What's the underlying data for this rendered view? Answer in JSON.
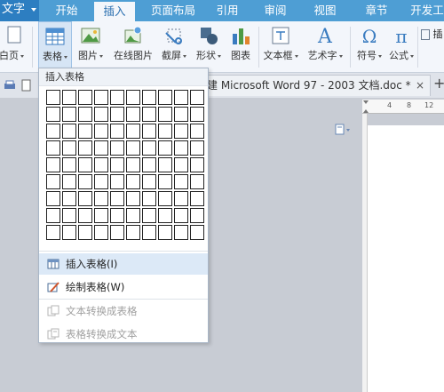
{
  "app_button": {
    "label": "文字"
  },
  "tabs": [
    {
      "label": "开始",
      "active": false
    },
    {
      "label": "插入",
      "active": true
    },
    {
      "label": "页面布局",
      "active": false
    },
    {
      "label": "引用",
      "active": false
    },
    {
      "label": "审阅",
      "active": false
    },
    {
      "label": "视图",
      "active": false
    },
    {
      "label": "章节",
      "active": false
    },
    {
      "label": "开发工",
      "active": false
    }
  ],
  "ribbon": {
    "cover_page": "白页",
    "table": "表格",
    "picture": "图片",
    "online_picture": "在线图片",
    "screenshot": "截屏",
    "shapes": "形状",
    "chart": "图表",
    "textbox": "文本框",
    "wordart": "艺术字",
    "symbol": "符号",
    "formula": "公式",
    "insert_short": "插"
  },
  "document_tab": {
    "title": "建 Microsoft Word 97 - 2003 文档.doc *",
    "close": "×"
  },
  "new_tab": "+",
  "ruler": {
    "ticks": [
      "4",
      "8",
      "12"
    ]
  },
  "table_menu": {
    "header": "插入表格",
    "grid_columns": 10,
    "grid_rows": 9,
    "items": [
      {
        "label": "插入表格(I)",
        "icon": "insert-table-icon",
        "enabled": true,
        "highlighted": true
      },
      {
        "label": "绘制表格(W)",
        "icon": "draw-table-icon",
        "enabled": true,
        "highlighted": false
      },
      {
        "label": "文本转换成表格",
        "icon": "text-to-table-icon",
        "enabled": false,
        "highlighted": false
      },
      {
        "label": "表格转换成文本",
        "icon": "table-to-text-icon",
        "enabled": false,
        "highlighted": false
      }
    ]
  },
  "colors": {
    "tab_bar": "#4e9ed4",
    "accent": "#2d7ec1",
    "menu_highlight": "#dce9f7"
  }
}
